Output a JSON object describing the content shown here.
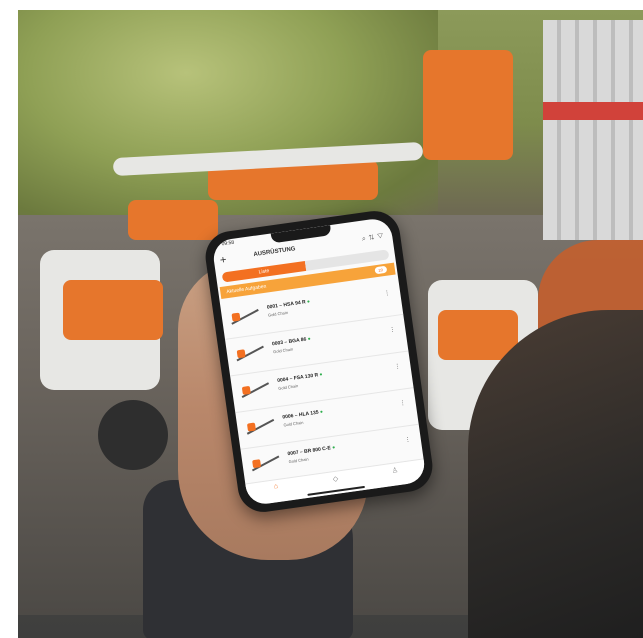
{
  "phone": {
    "status_time": "09:58",
    "app_title": "AUSRÜSTUNG",
    "add_icon": "plus-icon",
    "header_icons": [
      "search-icon",
      "sort-icon",
      "filter-icon"
    ],
    "tabs": [
      {
        "label": "Liste",
        "active": true
      },
      {
        "label": "",
        "active": false
      }
    ],
    "section": {
      "label": "Aktuelle Aufgaben",
      "count": "20"
    },
    "items": [
      {
        "name": "0001 – HSA 94 R",
        "sub": "Gold Chain"
      },
      {
        "name": "0003 – BGA 86",
        "sub": "Gold Chain"
      },
      {
        "name": "0004 – FSA 130 R",
        "sub": "Gold Chain"
      },
      {
        "name": "0006 – HLA 135",
        "sub": "Gold Chain"
      },
      {
        "name": "0007 – BR 800 C-E",
        "sub": "Gold Chain"
      }
    ],
    "bottom_nav": [
      {
        "icon": "home-icon",
        "active": true
      },
      {
        "icon": "map-icon",
        "active": false
      },
      {
        "icon": "profile-icon",
        "active": false
      }
    ]
  }
}
